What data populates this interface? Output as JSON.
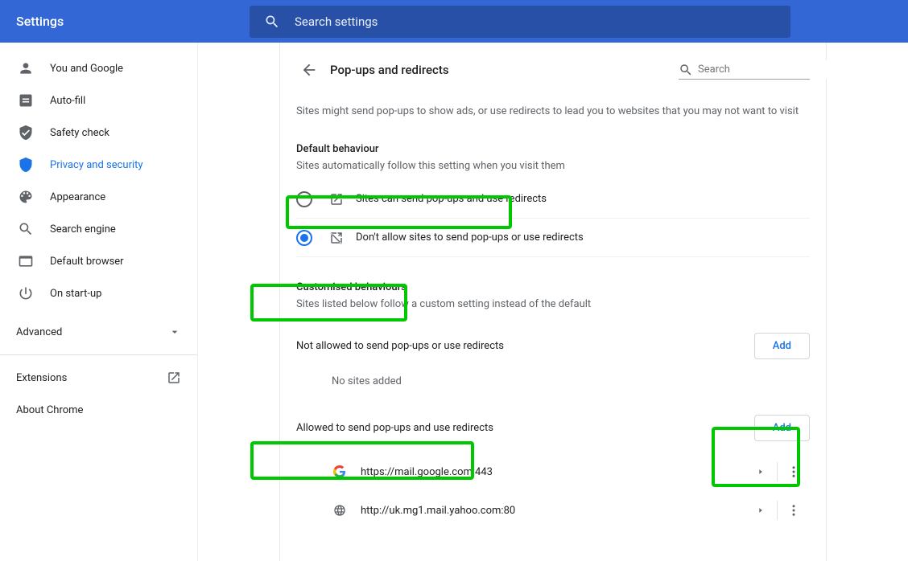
{
  "header": {
    "title": "Settings",
    "search_placeholder": "Search settings"
  },
  "sidebar": {
    "items": [
      {
        "label": "You and Google"
      },
      {
        "label": "Auto-fill"
      },
      {
        "label": "Safety check"
      },
      {
        "label": "Privacy and security"
      },
      {
        "label": "Appearance"
      },
      {
        "label": "Search engine"
      },
      {
        "label": "Default browser"
      },
      {
        "label": "On start-up"
      }
    ],
    "advanced_label": "Advanced",
    "extensions_label": "Extensions",
    "about_label": "About Chrome"
  },
  "page": {
    "title": "Pop-ups and redirects",
    "search_placeholder": "Search",
    "intro": "Sites might send pop-ups to show ads, or use redirects to lead you to websites that you may not want to visit",
    "default_behaviour_title": "Default behaviour",
    "default_behaviour_sub": "Sites automatically follow this setting when you visit them",
    "radio_allow": "Sites can send pop-ups and use redirects",
    "radio_block": "Don't allow sites to send pop-ups or use redirects",
    "custom_title": "Customised behaviours",
    "custom_sub": "Sites listed below follow a custom setting instead of the default",
    "not_allowed_title": "Not allowed to send pop-ups or use redirects",
    "add_label": "Add",
    "no_sites": "No sites added",
    "allowed_title": "Allowed to send pop-ups and use redirects",
    "allowed_sites": [
      {
        "url": "https://mail.google.com:443",
        "icon": "google"
      },
      {
        "url": "http://uk.mg1.mail.yahoo.com:80",
        "icon": "globe"
      }
    ]
  }
}
